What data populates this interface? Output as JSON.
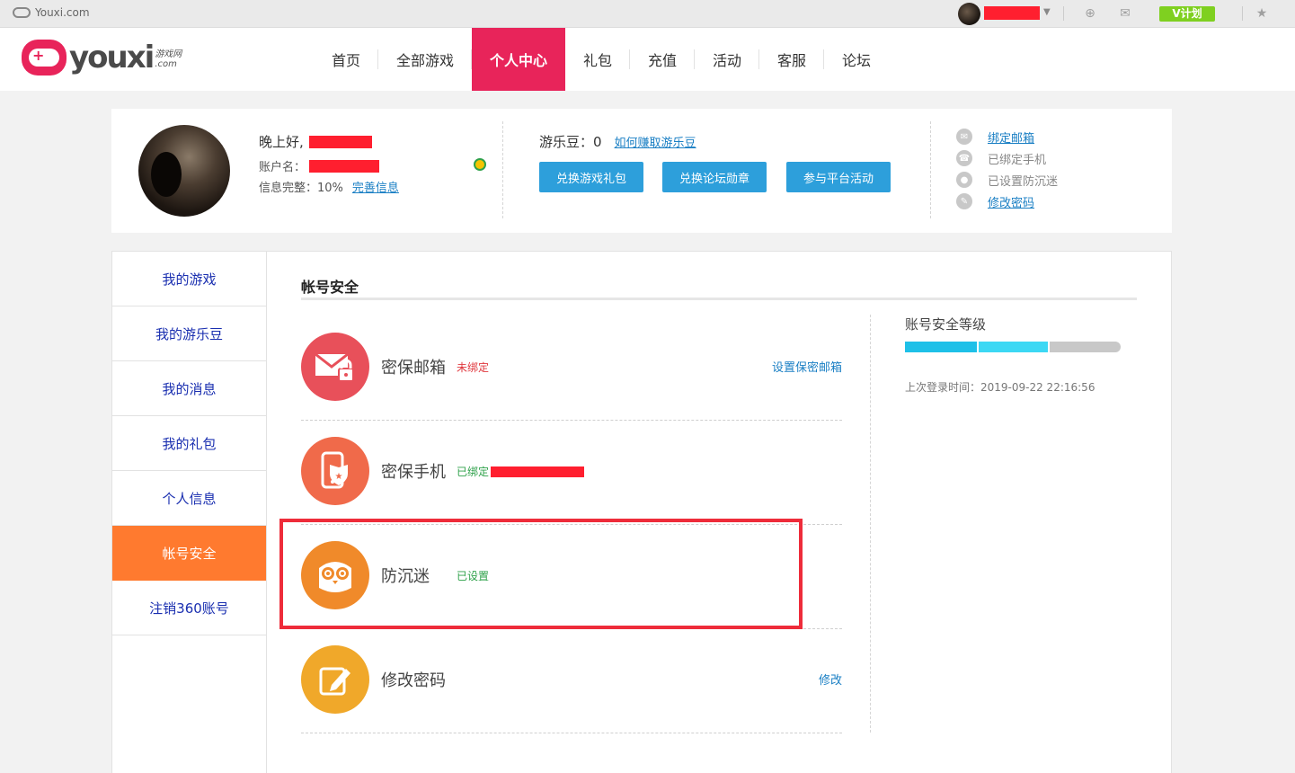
{
  "topbar": {
    "site_name": "Youxi.com",
    "vplan_label": "V计划"
  },
  "header": {
    "logo_text": "youxi",
    "logo_sub_top": "游戏网",
    "logo_sub_bottom": ".com",
    "nav": [
      {
        "label": "首页"
      },
      {
        "label": "全部游戏"
      },
      {
        "label": "个人中心",
        "active": true
      },
      {
        "label": "礼包"
      },
      {
        "label": "充值"
      },
      {
        "label": "活动"
      },
      {
        "label": "客服"
      },
      {
        "label": "论坛"
      }
    ]
  },
  "profile": {
    "greeting": "晚上好,",
    "account_label": "账户名：",
    "info_complete": "信息完整：10%",
    "complete_link": "完善信息",
    "beans_label": "游乐豆：0",
    "beans_link": "如何赚取游乐豆",
    "buttons": [
      "兑换游戏礼包",
      "兑换论坛勋章",
      "参与平台活动"
    ],
    "quick_links": [
      {
        "label": "绑定邮箱",
        "link": true
      },
      {
        "label": "已绑定手机",
        "link": false
      },
      {
        "label": "已设置防沉迷",
        "link": false
      },
      {
        "label": "修改密码",
        "link": true
      }
    ]
  },
  "sidebar": {
    "items": [
      {
        "label": "我的游戏"
      },
      {
        "label": "我的游乐豆"
      },
      {
        "label": "我的消息"
      },
      {
        "label": "我的礼包"
      },
      {
        "label": "个人信息"
      },
      {
        "label": "帐号安全",
        "active": true
      },
      {
        "label": "注销360账号"
      }
    ]
  },
  "security": {
    "title": "帐号安全",
    "rows": [
      {
        "name": "密保邮箱",
        "status": "未绑定",
        "status_color": "#e0383e",
        "action": "设置保密邮箱",
        "icon": "mail-lock-icon",
        "icon_color": "#e8505a"
      },
      {
        "name": "密保手机",
        "status": "已绑定",
        "status_color": "#2fa14a",
        "action": "",
        "icon": "phone-shield-icon",
        "icon_color": "#f06a4a"
      },
      {
        "name": "防沉迷",
        "status": "已设置",
        "status_color": "#2fa14a",
        "action": "",
        "icon": "owl-icon",
        "icon_color": "#f08a2a"
      },
      {
        "name": "修改密码",
        "status": "",
        "status_color": "#2fa14a",
        "action": "修改",
        "icon": "edit-icon",
        "icon_color": "#f0a82a"
      }
    ],
    "level_title": "账号安全等级",
    "level_segments": [
      {
        "color": "#1ec0e8",
        "filled": true
      },
      {
        "color": "#3cd8f4",
        "filled": true
      },
      {
        "color": "#c8c8c8",
        "filled": false
      }
    ],
    "last_login": "上次登录时间：2019-09-22 22:16:56"
  }
}
